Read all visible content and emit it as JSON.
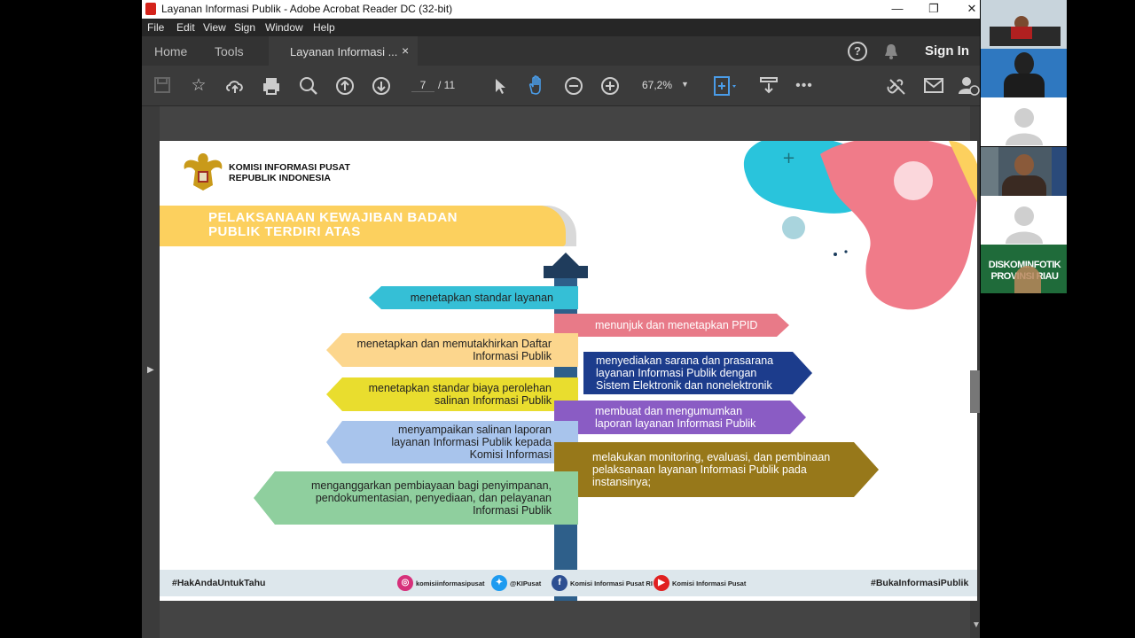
{
  "window": {
    "title": "Layanan Informasi Publik - Adobe Acrobat Reader DC (32-bit)",
    "controls": {
      "minimize": "—",
      "restore": "❐",
      "close": "✕"
    }
  },
  "menu": [
    "File",
    "Edit",
    "View",
    "Sign",
    "Window",
    "Help"
  ],
  "tabs": {
    "home": "Home",
    "tools": "Tools",
    "doc": "Layanan Informasi ...",
    "doc_close": "×"
  },
  "header_right": {
    "help": "?",
    "sign_in": "Sign In"
  },
  "toolbar": {
    "page_current": "7",
    "page_total": "/ 11",
    "zoom": "67,2%"
  },
  "slide": {
    "org_line1": "KOMISI INFORMASI PUSAT",
    "org_line2": "REPUBLIK INDONESIA",
    "banner_line1": "PELAKSANAAN KEWAJIBAN BADAN",
    "banner_line2": "PUBLIK TERDIRI ATAS",
    "signs": [
      {
        "text": "menetapkan standar layanan",
        "color": "#35bfd6"
      },
      {
        "text": "menunjuk dan menetapkan PPID",
        "color": "#e87a88"
      },
      {
        "text": "menetapkan dan memutakhirkan Daftar Informasi Publik",
        "color": "#fcd68d"
      },
      {
        "text": "menyediakan sarana dan prasarana layanan Informasi Publik dengan Sistem Elektronik dan nonelektronik",
        "color": "#1c3c8c"
      },
      {
        "text": "menetapkan standar biaya perolehan salinan Informasi Publik",
        "color": "#e9dd2e"
      },
      {
        "text": "membuat dan mengumumkan laporan layanan Informasi Publik",
        "color": "#8a5cc4"
      },
      {
        "text": "menyampaikan salinan laporan layanan Informasi Publik kepada Komisi Informasi",
        "color": "#a8c4ec"
      },
      {
        "text": "melakukan monitoring, evaluasi, dan pembinaan pelaksanaan layanan Informasi Publik pada instansinya;",
        "color": "#97781a"
      },
      {
        "text": "menganggarkan pembiayaan bagi penyimpanan, pendokumentasian, penyediaan, dan pelayanan Informasi Publik",
        "color": "#8fcf9e"
      }
    ],
    "footer": {
      "hashtag_left": "#HakAndaUntukTahu",
      "instagram": "komisiinformasipusat",
      "twitter": "@KIPusat",
      "facebook": "Komisi Informasi Pusat RI",
      "youtube": "Komisi Informasi Pusat",
      "hashtag_right": "#BukaInformasiPublik"
    }
  },
  "video": {
    "tile6_label": "DISKOMINFOTIK PROVINSI RIAU"
  },
  "colors": {
    "accent_blue": "#4a9ce8",
    "banner": "#fcd05e"
  }
}
